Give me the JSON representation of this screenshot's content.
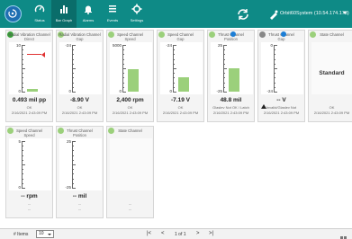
{
  "header": {
    "nav": [
      {
        "label": "Status",
        "icon": "speedometer-icon"
      },
      {
        "label": "Bar Graph",
        "icon": "bar-graph-icon"
      },
      {
        "label": "Alarms",
        "icon": "bell-alarm-icon"
      },
      {
        "label": "Events",
        "icon": "list-events-icon"
      },
      {
        "label": "Settings",
        "icon": "gear-icon"
      }
    ],
    "active_tab": "Bar Graph",
    "system_name": "Orbit60System (10.54.174.173)"
  },
  "tiles": [
    {
      "name": "Radial Vibration Channel",
      "sub": "Direct",
      "status_color": "#3aa13a",
      "scale_top": "10",
      "scale_bottom": "0",
      "fill_level": 0.05,
      "value": "0.493 mil pp",
      "status": "OK",
      "timestamp": "2/16/2021 2:43:09 PM",
      "alarm_marker": true
    },
    {
      "name": "Radial Vibration Channel",
      "sub": "Gap",
      "status_color": "#9bd07b",
      "scale_top": "-24",
      "scale_bottom": "0",
      "fill_level": 0,
      "value": "-8.90 V",
      "status": "OK",
      "timestamp": "2/16/2021 2:43:09 PM"
    },
    {
      "name": "Speed Channel",
      "sub": "Speed",
      "status_color": "#9bd07b",
      "scale_top": "5000",
      "scale_bottom": "0",
      "fill_level": 0.48,
      "value": "2,400 rpm",
      "status": "OK",
      "timestamp": "2/16/2021 2:43:09 PM"
    },
    {
      "name": "Speed Channel",
      "sub": "Gap",
      "status_color": "#9bd07b",
      "scale_top": "-24",
      "scale_bottom": "0",
      "fill_level": 0.3,
      "value": "-7.19 V",
      "status": "OK",
      "timestamp": "2/16/2021 2:43:09 PM"
    },
    {
      "name": "Thrust Channel",
      "sub": "Position",
      "status_color": "#9bd07b",
      "scale_top": "25",
      "scale_bottom": "-25",
      "fill_level": 0.5,
      "value": "48.8 mil",
      "status": "Glaslev Not OK / Latch",
      "timestamp": "2/16/2021 2:43:09 PM",
      "locked": true
    },
    {
      "name": "Thrust Channel",
      "sub": "Gap",
      "status_color": "#888888",
      "scale_top": "0",
      "scale_bottom": "-24",
      "fill_level": 0,
      "value": "-- V",
      "status": "Invalid/Glaslev Not",
      "timestamp": "2/16/2021 2:43:09 PM",
      "locked": true,
      "warning": true
    },
    {
      "name": "State Channel",
      "sub": "",
      "status_color": "#9bd07b",
      "state_text": "Standard",
      "status": "OK",
      "timestamp": "2/16/2021 2:43:09 PM"
    },
    {
      "name": "Speed Channel",
      "sub": "Speed",
      "status_color": "#9bd07b",
      "scale_top": "5",
      "scale_bottom": "0",
      "fill_level": 0,
      "value": "-- rpm",
      "status": "--",
      "timestamp": "--"
    },
    {
      "name": "Thrust Channel",
      "sub": "Position",
      "status_color": "#9bd07b",
      "scale_top": "25",
      "scale_bottom": "-25",
      "fill_level": 0,
      "value": "-- mil",
      "status": "--",
      "timestamp": "--"
    },
    {
      "name": "State Channel",
      "sub": "",
      "status_color": "#9bd07b",
      "state_text": "",
      "status": "--",
      "timestamp": "--"
    }
  ],
  "footer": {
    "items_label": "# Items",
    "items_value": "10",
    "page_text": "1 of 1",
    "first": "|<",
    "prev": "<",
    "next": ">",
    "last": ">|"
  }
}
